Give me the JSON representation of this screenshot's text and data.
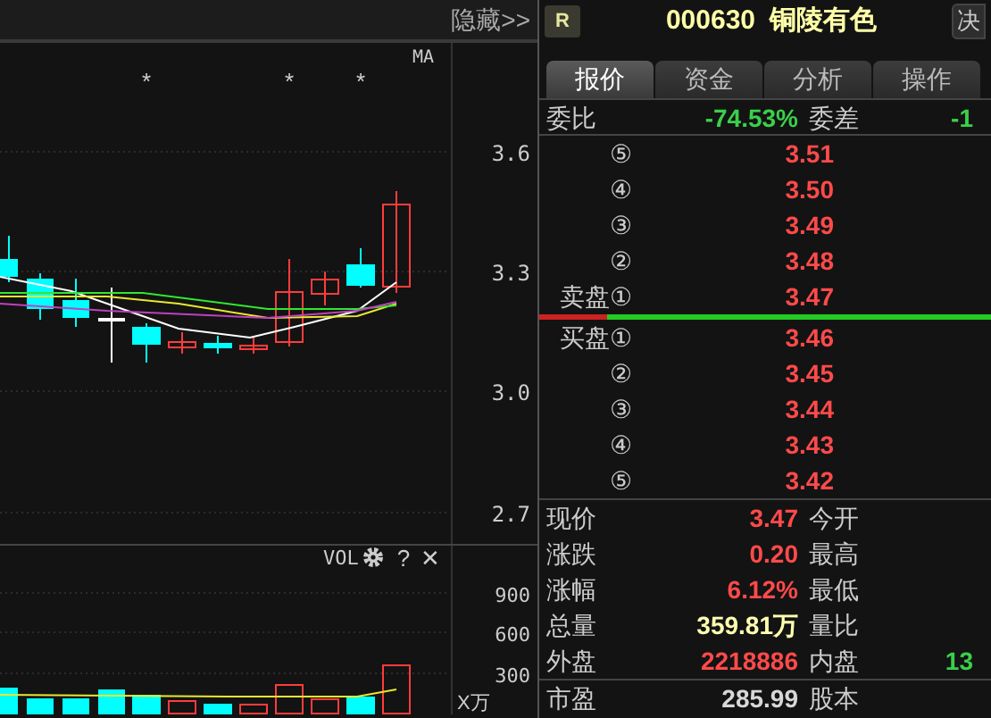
{
  "left_panel": {
    "hide_button": "隐藏>>",
    "ma_label": "MA",
    "markers": [
      "*",
      "*",
      "*"
    ],
    "price_ticks": [
      "3.6",
      "3.3",
      "3.0",
      "2.7"
    ],
    "volume_toolbar": {
      "label": "VOL",
      "help": "?",
      "close": "✕"
    },
    "volume_ticks": [
      "900",
      "600",
      "300"
    ],
    "volume_unit": "X万"
  },
  "quote_panel": {
    "badge": "R",
    "code": "000630",
    "name": "铜陵有色",
    "side_button": "决",
    "tabs": [
      {
        "label": "报价",
        "selected": true
      },
      {
        "label": "资金",
        "selected": false
      },
      {
        "label": "分析",
        "selected": false
      },
      {
        "label": "操作",
        "selected": false
      }
    ],
    "commission": {
      "label": "委比",
      "value": "-74.53%",
      "label2": "委差",
      "value2": "-1"
    },
    "asks": [
      {
        "label": "⑤",
        "price": "3.51"
      },
      {
        "label": "④",
        "price": "3.50"
      },
      {
        "label": "③",
        "price": "3.49"
      },
      {
        "label": "②",
        "price": "3.48"
      },
      {
        "label": "卖盘①",
        "price": "3.47"
      }
    ],
    "ratio_bar": {
      "level": 0.15
    },
    "bids": [
      {
        "label": "买盘①",
        "price": "3.46"
      },
      {
        "label": "②",
        "price": "3.45"
      },
      {
        "label": "③",
        "price": "3.44"
      },
      {
        "label": "④",
        "price": "3.43"
      },
      {
        "label": "⑤",
        "price": "3.42"
      }
    ],
    "stats": [
      {
        "label": "现价",
        "value": "3.47",
        "color": "#ff4a4a",
        "label2": "今开"
      },
      {
        "label": "涨跌",
        "value": "0.20",
        "color": "#ff4a4a",
        "label2": "最高"
      },
      {
        "label": "涨幅",
        "value": "6.12%",
        "color": "#ff4a4a",
        "label2": "最低"
      },
      {
        "label": "总量",
        "value": "359.81万",
        "color": "#ffffb0",
        "label2": "量比"
      },
      {
        "label": "外盘",
        "value": "2218886",
        "color": "#ff4a4a",
        "label2": "内盘",
        "value2": {
          "text": "13",
          "color": "#3ad04a"
        }
      }
    ],
    "stats2": [
      {
        "label": "市盈",
        "value": "285.99",
        "color": "#d8d8d8",
        "label2": "股本"
      }
    ]
  }
}
